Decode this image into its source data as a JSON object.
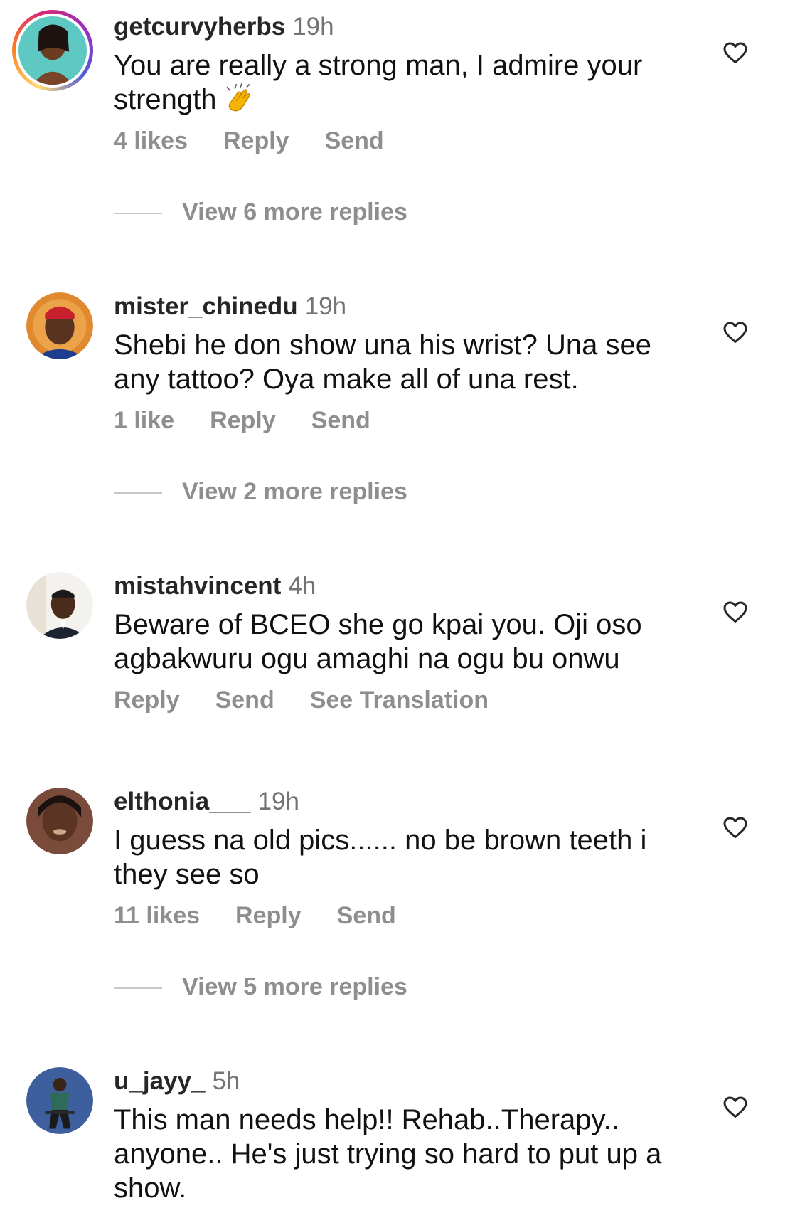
{
  "colors": {
    "text": "#111111",
    "username": "#262626",
    "muted": "#8e8e8e",
    "rule": "#c7c7c7"
  },
  "comments": [
    {
      "username": "getcurvyherbs",
      "time": "19h",
      "text": "You are really a strong man, I admire your strength",
      "emoji": "clapping-hands",
      "avatar_icon": "story-ring-avatar",
      "likes": "4 likes",
      "reply": "Reply",
      "send": "Send",
      "view_more": "View 6 more replies"
    },
    {
      "username": "mister_chinedu",
      "time": "19h",
      "text": "Shebi he don show una his wrist? Una see any tattoo? Oya make all of una rest.",
      "avatar_icon": "avatar",
      "likes": "1 like",
      "reply": "Reply",
      "send": "Send",
      "view_more": "View 2 more replies"
    },
    {
      "username": "mistahvincent",
      "time": "4h",
      "text": "Beware of BCEO she go kpai you. Oji oso agbakwuru ogu amaghi na ogu bu onwu",
      "avatar_icon": "avatar",
      "reply": "Reply",
      "send": "Send",
      "translate": "See Translation"
    },
    {
      "username": "elthonia___",
      "time": "19h",
      "text": "I guess na old pics...... no be brown teeth i they see so",
      "avatar_icon": "avatar",
      "likes": "11 likes",
      "reply": "Reply",
      "send": "Send",
      "view_more": "View 5 more replies"
    },
    {
      "username": "u_jayy_",
      "time": "5h",
      "text": "This man needs help!! Rehab..Therapy.. anyone.. He's just trying so hard to put up a show.",
      "avatar_icon": "avatar"
    }
  ]
}
